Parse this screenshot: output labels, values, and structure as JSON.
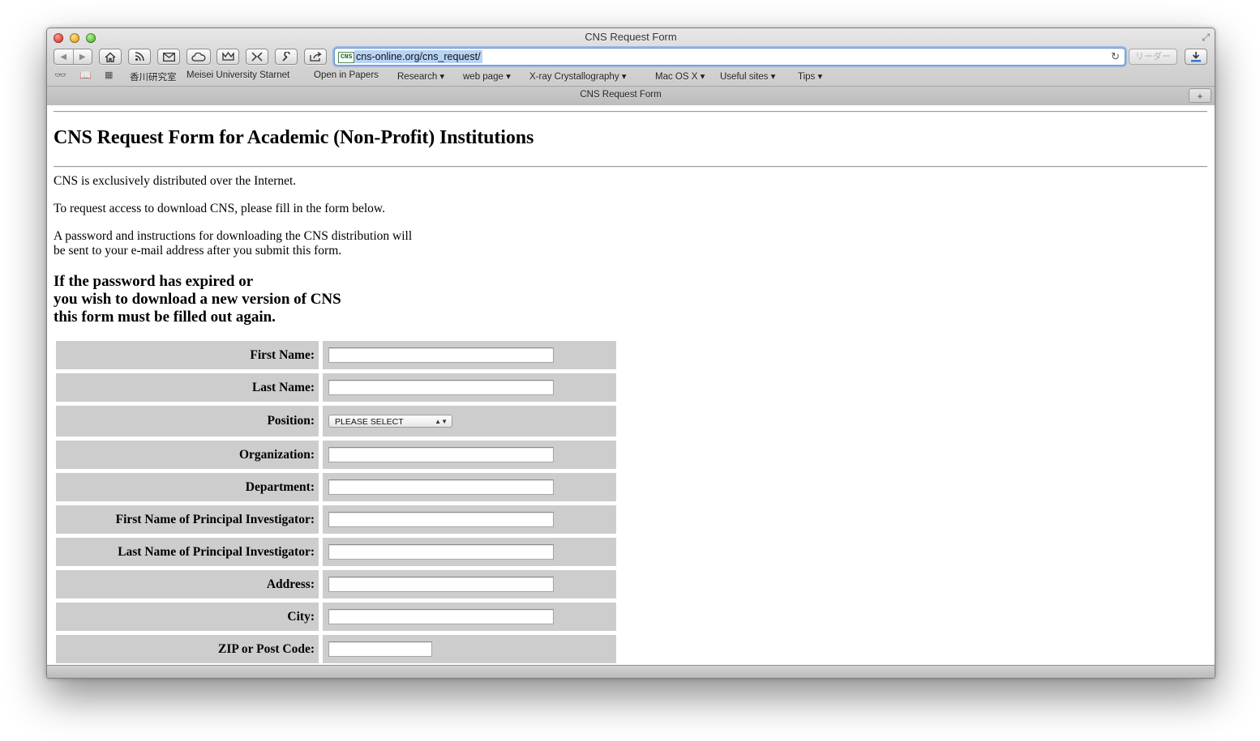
{
  "window": {
    "title": "CNS Request Form"
  },
  "toolbar": {
    "back": "◀",
    "forward": "▶",
    "url": "cns-online.org/cns_request/",
    "favicon_text": "CNS",
    "reader_label": "リーダー"
  },
  "bookmarks": [
    {
      "label": "香川研究室"
    },
    {
      "label": "Meisei University Starnet"
    },
    {
      "label": "Open in Papers"
    },
    {
      "label": "Research ▾"
    },
    {
      "label": "web page ▾"
    },
    {
      "label": "X-ray Crystallography ▾"
    },
    {
      "label": "Mac OS X ▾"
    },
    {
      "label": "Useful sites ▾"
    },
    {
      "label": "Tips ▾"
    }
  ],
  "tab": {
    "title": "CNS Request Form",
    "new_tab": "+"
  },
  "page": {
    "heading": "CNS Request Form for Academic (Non-Profit) Institutions",
    "intro1": "CNS is exclusively distributed over the Internet.",
    "intro2": "To request access to download CNS, please fill in the form below.",
    "intro3_line1": "A password and instructions for downloading the CNS distribution will",
    "intro3_line2": "be sent to your e-mail address after you submit this form.",
    "notice_line1": "If the password has expired or",
    "notice_line2": "you wish to download a new version of CNS",
    "notice_line3": "this form must be filled out again.",
    "form": {
      "first_name": "First Name:",
      "last_name": "Last Name:",
      "position": "Position:",
      "position_selected": "PLEASE SELECT",
      "organization": "Organization:",
      "department": "Department:",
      "pi_first": "First Name of Principal Investigator:",
      "pi_last": "Last Name of Principal Investigator:",
      "address": "Address:",
      "city": "City:",
      "zip": "ZIP or Post Code:"
    }
  }
}
